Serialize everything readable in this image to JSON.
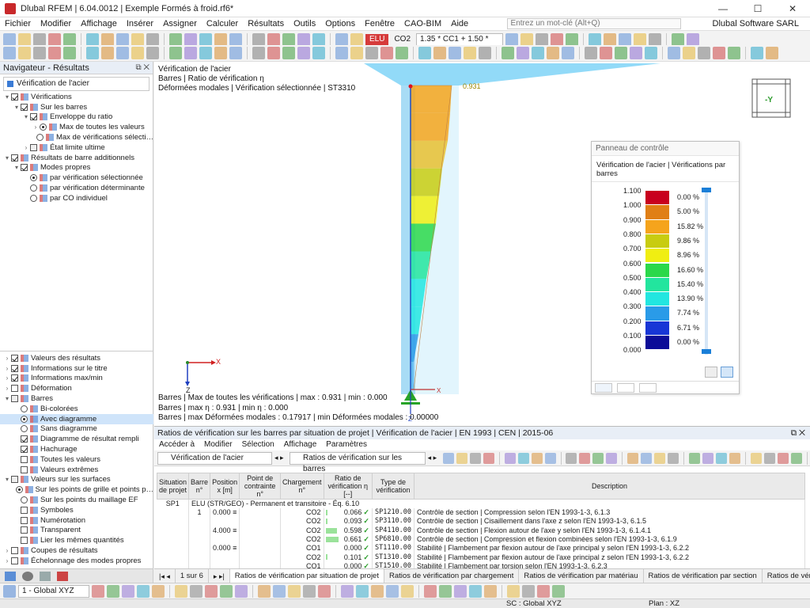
{
  "window": {
    "title": "Dlubal RFEM | 6.04.0012 | Exemple Formés à froid.rf6*",
    "controls": [
      "—",
      "☐",
      "✕"
    ]
  },
  "menu": {
    "items": [
      "Fichier",
      "Modifier",
      "Affichage",
      "Insérer",
      "Assigner",
      "Calculer",
      "Résultats",
      "Outils",
      "Options",
      "Fenêtre",
      "CAO-BIM",
      "Aide"
    ],
    "search_placeholder": "Entrez un mot-clé (Alt+Q)",
    "company": "Dlubal Software SARL"
  },
  "toolbar": {
    "elu_badge": "ELU",
    "co_label": "CO2",
    "combo_text": "1.35 * CC1 + 1.50 * CC2"
  },
  "navigator": {
    "title": "Navigateur - Résultats",
    "selector": "Vérification de l'acier",
    "upper": [
      {
        "label": "Vérifications",
        "level": 0,
        "type": "chk",
        "state": "on",
        "exp": "▾"
      },
      {
        "label": "Sur les barres",
        "level": 1,
        "type": "chk",
        "state": "on",
        "exp": "▾"
      },
      {
        "label": "Enveloppe du ratio",
        "level": 2,
        "type": "chk",
        "state": "on",
        "exp": "▾"
      },
      {
        "label": "Max de toutes les valeurs",
        "level": 3,
        "type": "rad",
        "state": "on",
        "exp": "›"
      },
      {
        "label": "Max de vérifications sélecti…",
        "level": 3,
        "type": "rad",
        "state": "off",
        "exp": ""
      },
      {
        "label": "État limite ultime",
        "level": 2,
        "type": "chk",
        "state": "part",
        "exp": "›"
      },
      {
        "label": "Résultats de barre additionnels",
        "level": 0,
        "type": "chk",
        "state": "on",
        "exp": "▾"
      },
      {
        "label": "Modes propres",
        "level": 1,
        "type": "chk",
        "state": "on",
        "exp": "▾"
      },
      {
        "label": "par vérification sélectionnée",
        "level": 2,
        "type": "rad",
        "state": "on",
        "exp": ""
      },
      {
        "label": "par vérification déterminante",
        "level": 2,
        "type": "rad",
        "state": "off",
        "exp": ""
      },
      {
        "label": "par CO individuel",
        "level": 2,
        "type": "rad",
        "state": "off",
        "exp": ""
      }
    ],
    "lower": [
      {
        "label": "Valeurs des résultats",
        "level": 0,
        "type": "chk",
        "state": "on",
        "exp": "›"
      },
      {
        "label": "Informations sur le titre",
        "level": 0,
        "type": "chk",
        "state": "on",
        "exp": "›"
      },
      {
        "label": "Informations max/min",
        "level": 0,
        "type": "chk",
        "state": "on",
        "exp": "›"
      },
      {
        "label": "Déformation",
        "level": 0,
        "type": "chk",
        "state": "off",
        "exp": "›"
      },
      {
        "label": "Barres",
        "level": 0,
        "type": "chk",
        "state": "part",
        "exp": "▾"
      },
      {
        "label": "Bi-colorées",
        "level": 1,
        "type": "rad",
        "state": "off",
        "exp": ""
      },
      {
        "label": "Avec diagramme",
        "level": 1,
        "type": "rad",
        "state": "on",
        "exp": "",
        "hl": true
      },
      {
        "label": "Sans diagramme",
        "level": 1,
        "type": "rad",
        "state": "off",
        "exp": ""
      },
      {
        "label": "Diagramme de résultat rempli",
        "level": 1,
        "type": "chk",
        "state": "on",
        "exp": ""
      },
      {
        "label": "Hachurage",
        "level": 1,
        "type": "chk",
        "state": "on",
        "exp": ""
      },
      {
        "label": "Toutes les valeurs",
        "level": 1,
        "type": "chk",
        "state": "off",
        "exp": ""
      },
      {
        "label": "Valeurs extrêmes",
        "level": 1,
        "type": "chk",
        "state": "off",
        "exp": ""
      },
      {
        "label": "Valeurs sur les surfaces",
        "level": 0,
        "type": "chk",
        "state": "part",
        "exp": "▾"
      },
      {
        "label": "Sur les points de grille et points p…",
        "level": 1,
        "type": "rad",
        "state": "on",
        "exp": ""
      },
      {
        "label": "Sur les points du maillage EF",
        "level": 1,
        "type": "rad",
        "state": "off",
        "exp": ""
      },
      {
        "label": "Symboles",
        "level": 1,
        "type": "chk",
        "state": "off",
        "exp": ""
      },
      {
        "label": "Numérotation",
        "level": 1,
        "type": "chk",
        "state": "off",
        "exp": ""
      },
      {
        "label": "Transparent",
        "level": 1,
        "type": "chk",
        "state": "off",
        "exp": ""
      },
      {
        "label": "Lier les mêmes quantités",
        "level": 1,
        "type": "chk",
        "state": "off",
        "exp": ""
      },
      {
        "label": "Coupes de résultats",
        "level": 0,
        "type": "chk",
        "state": "off",
        "exp": "›"
      },
      {
        "label": "Échelonnage des modes propres",
        "level": 0,
        "type": "chk",
        "state": "off",
        "exp": "›"
      }
    ]
  },
  "viewport": {
    "header_lines": [
      "Vérification de l'acier",
      "Barres | Ratio de vérification η",
      "Déformées modales | Vérification sélectionnée | ST3310"
    ],
    "max_label": "0.931",
    "footer_lines": [
      "Barres | Max de toutes les vérifications | max  : 0.931 | min  : 0.000",
      "Barres | max η : 0.931 | min η : 0.000",
      "Barres | max Déformées modales : 0.17917 | min Déformées modales : 0.00000"
    ],
    "nav_cube_label": "-Y",
    "axis_x": "X",
    "axis_z": "Z",
    "support_x": "X",
    "support_z": "Z"
  },
  "control_panel": {
    "title": "Panneau de contrôle",
    "subtitle": "Vérification de l'acier | Vérifications par barres",
    "legend": [
      {
        "value": "1.100",
        "color": "#c8001e",
        "pct": "0.00 %"
      },
      {
        "value": "1.000",
        "color": "#e07f16",
        "pct": "5.00 %"
      },
      {
        "value": "0.900",
        "color": "#f5a41c",
        "pct": "15.82 %"
      },
      {
        "value": "0.800",
        "color": "#c8cc10",
        "pct": "9.86 %"
      },
      {
        "value": "0.700",
        "color": "#f0ee12",
        "pct": "8.96 %"
      },
      {
        "value": "0.600",
        "color": "#2bd84a",
        "pct": "16.60 %"
      },
      {
        "value": "0.500",
        "color": "#22e59e",
        "pct": "15.40 %"
      },
      {
        "value": "0.400",
        "color": "#22e6e0",
        "pct": "13.90 %"
      },
      {
        "value": "0.300",
        "color": "#2a9be8",
        "pct": "7.74 %"
      },
      {
        "value": "0.200",
        "color": "#1836d6",
        "pct": "6.71 %"
      },
      {
        "value": "0.100",
        "color": "#0c0c98",
        "pct": "0.00 %"
      },
      {
        "value": "0.000"
      }
    ]
  },
  "results": {
    "title": "Ratios de vérification sur les barres par situation de projet | Vérification de l'acier | EN 1993 | CEN | 2015-06",
    "menu": [
      "Accéder à",
      "Modifier",
      "Sélection",
      "Affichage",
      "Paramètres"
    ],
    "combo1": "Vérification de l'acier",
    "combo2": "Ratios de vérification sur les barres",
    "columns": [
      "Situation de projet",
      "Barre n°",
      "Position x [m]",
      "Point de contrainte n°",
      "Chargement n°",
      "Ratio de vérification η [--]",
      "Type de vérification",
      "Description"
    ],
    "situation": {
      "id": "SP1",
      "label": "ELU (STR/GEO) - Permanent et transitoire - Éq. 6.10"
    },
    "rows": [
      {
        "bar": "1",
        "pos": "0.000 ≡",
        "load": "CO2",
        "ratio": 0.066,
        "ratio_txt": "0.066",
        "type": "SP1210.00",
        "desc": "Contrôle de section | Compression selon l'EN 1993-1-3, 6.1.3"
      },
      {
        "bar": "",
        "pos": "",
        "load": "CO2",
        "ratio": 0.093,
        "ratio_txt": "0.093",
        "type": "SP3110.00",
        "desc": "Contrôle de section | Cisaillement dans l'axe z selon l'EN 1993-1-3, 6.1.5"
      },
      {
        "bar": "",
        "pos": "4.000 ≡",
        "load": "CO2",
        "ratio": 0.598,
        "ratio_txt": "0.598",
        "type": "SP4110.00",
        "desc": "Contrôle de section | Flexion autour de l'axe y selon l'EN 1993-1-3, 6.1.4.1"
      },
      {
        "bar": "",
        "pos": "",
        "load": "CO2",
        "ratio": 0.661,
        "ratio_txt": "0.661",
        "type": "SP6810.00",
        "desc": "Contrôle de section | Compression et flexion combinées selon l'EN 1993-1-3, 6.1.9"
      },
      {
        "bar": "",
        "pos": "0.000 ≡",
        "load": "CO1",
        "ratio": 0.0,
        "ratio_txt": "0.000",
        "type": "ST1110.00",
        "desc": "Stabilité | Flambement par flexion autour de l'axe principal y selon l'EN 1993-1-3, 6.2.2"
      },
      {
        "bar": "",
        "pos": "",
        "load": "CO2",
        "ratio": 0.101,
        "ratio_txt": "0.101",
        "type": "ST1310.00",
        "desc": "Stabilité | Flambement par flexion autour de l'axe principal z selon l'EN 1993-1-3, 6.2.2"
      },
      {
        "bar": "",
        "pos": "",
        "load": "CO1",
        "ratio": 0.0,
        "ratio_txt": "0.000",
        "type": "ST1510.00",
        "desc": "Stabilité | Flambement par torsion selon l'EN 1993-1-3, 6.2.3"
      },
      {
        "bar": "",
        "pos": "4.000 ≡",
        "load": "CO2",
        "ratio": 0.931,
        "ratio_txt": "0.931",
        "type": "ST3310.00",
        "desc": "Stabilité | Flexion et compression selon l'EN 1993-1-3, 6.2.5(2)",
        "sel": true
      }
    ]
  },
  "bottom_tabs": {
    "pager": "1 sur 6",
    "tabs": [
      "Ratios de vérification par situation de projet",
      "Ratios de vérification par chargement",
      "Ratios de vérification par matériau",
      "Ratios de vérification par section",
      "Ratios de vérification par barre"
    ]
  },
  "statusbar": {
    "coord_system": "1 - Global XYZ",
    "sc": "SC : Global XYZ",
    "plan": "Plan : XZ"
  }
}
